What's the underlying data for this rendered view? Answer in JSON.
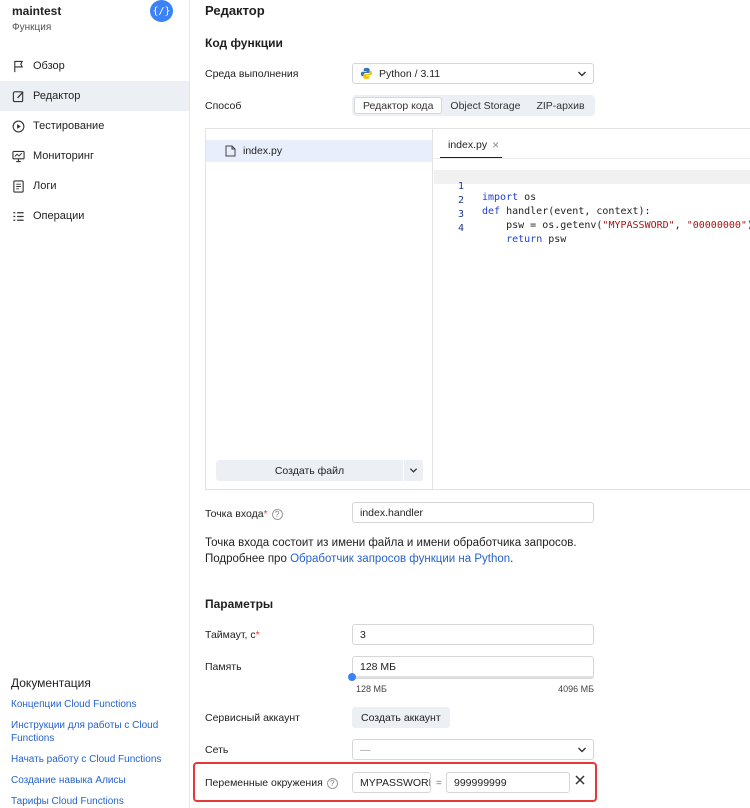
{
  "sidebar": {
    "app_name": "maintest",
    "app_type": "Функция",
    "badge": "{/}",
    "items": [
      {
        "label": "Обзор"
      },
      {
        "label": "Редактор"
      },
      {
        "label": "Тестирование"
      },
      {
        "label": "Мониторинг"
      },
      {
        "label": "Логи"
      },
      {
        "label": "Операции"
      }
    ],
    "docs_title": "Документация",
    "docs_links": [
      "Концепции Cloud Functions",
      "Инструкции для работы с Cloud Functions",
      "Начать работу с Cloud Functions",
      "Создание навыка Алисы",
      "Тарифы Cloud Functions"
    ]
  },
  "main": {
    "title": "Редактор",
    "code_section": "Код функции",
    "runtime_label": "Среда выполнения",
    "runtime_value": "Python / 3.11",
    "method_label": "Способ",
    "method_tabs": [
      "Редактор кода",
      "Object Storage",
      "ZIP-архив"
    ],
    "file_name": "index.py",
    "create_file": "Создать файл",
    "code_tab": "index.py",
    "code_lines": [
      {
        "n": "1",
        "kw": "import",
        "rest": " os"
      },
      {
        "n": "2",
        "kw": "def",
        "rest": " handler(event, context):"
      },
      {
        "n": "3",
        "pre": "    psw = os.getenv(",
        "s1": "\"MYPASSWORD\"",
        "mid": ", ",
        "s2": "\"00000000\"",
        "post": ")"
      },
      {
        "n": "4",
        "pre": "    ",
        "kw": "return",
        "rest": " psw"
      }
    ],
    "entry_label": "Точка входа",
    "entry_value": "index.handler",
    "entry_desc_1": "Точка входа состоит из имени файла и имени обработчика запросов.",
    "entry_desc_2": "Подробнее про ",
    "entry_desc_link": "Обработчик запросов функции на Python",
    "params_section": "Параметры",
    "timeout_label": "Таймаут, с",
    "timeout_value": "3",
    "memory_label": "Память",
    "memory_value": "128 МБ",
    "memory_min": "128 МБ",
    "memory_max": "4096 МБ",
    "memory_level": 0,
    "account_label": "Сервисный аккаунт",
    "account_button": "Создать аккаунт",
    "network_label": "Сеть",
    "network_value": "—",
    "env_label": "Переменные окружения",
    "env_key": "MYPASSWORD",
    "env_eq": "=",
    "env_value": "999999999"
  },
  "colors": {
    "accent": "#3b82f6",
    "link": "#2563c9",
    "highlight_border": "#e53935"
  }
}
